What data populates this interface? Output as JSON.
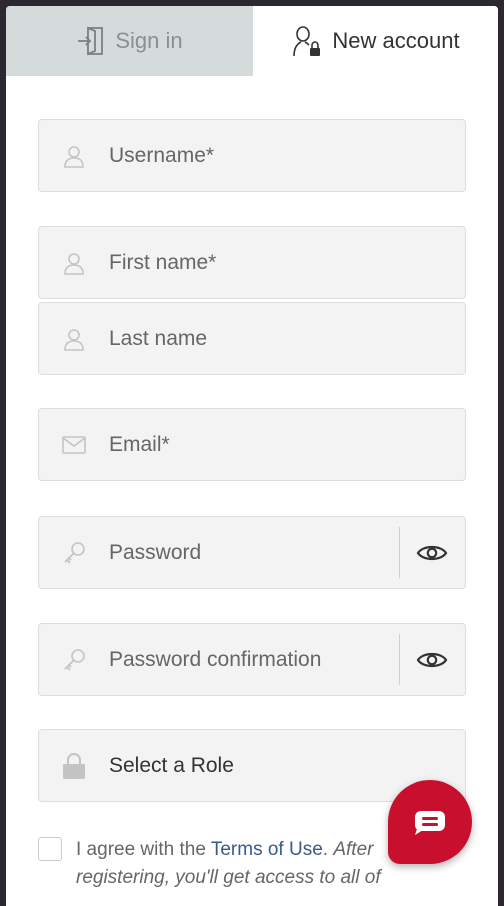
{
  "tabs": {
    "sign_in": "Sign in",
    "new_account": "New account"
  },
  "form": {
    "username": "Username*",
    "first_name": "First name*",
    "last_name": "Last name",
    "email": "Email*",
    "password": "Password",
    "password_confirmation": "Password confirmation",
    "role": "Select a Role"
  },
  "agree": {
    "prefix": "I agree with the ",
    "terms_link": "Terms of Use",
    "suffix": ". ",
    "continuation": "After registering, you'll get access to all of"
  },
  "colors": {
    "accent": "#c8102e",
    "link": "#3a5a8c",
    "inactive_tab": "#d5dbdb"
  },
  "icons": {
    "sign_in": "sign-in-door-icon",
    "new_account": "user-lock-icon",
    "person": "person-icon",
    "email": "envelope-icon",
    "password": "key-icon",
    "visibility": "eye-icon",
    "role": "padlock-icon",
    "chat": "chat-icon"
  }
}
